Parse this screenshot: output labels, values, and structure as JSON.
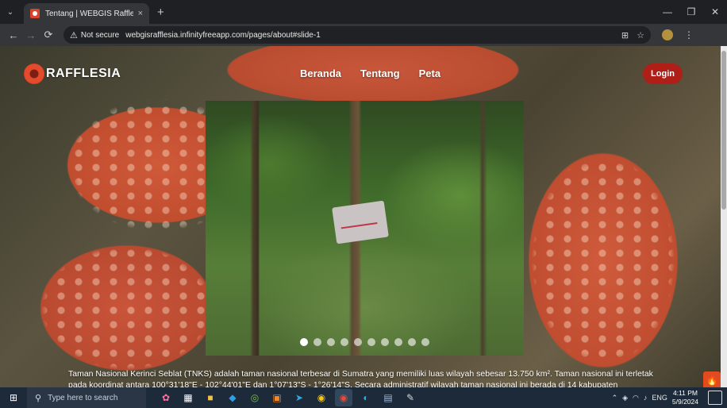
{
  "browser": {
    "tab": {
      "title": "Tentang | WEBGIS Rafflesia SP",
      "close": "×"
    },
    "new_tab": "+",
    "window_controls": {
      "minimize": "—",
      "restore": "❐",
      "close": "✕"
    },
    "nav": {
      "back": "←",
      "forward": "→",
      "reload": "⟳"
    },
    "security": {
      "icon": "⚠",
      "label": "Not secure"
    },
    "url": "webgisrafflesia.infinityfreeapp.com/pages/about#slide-1",
    "omni_icons": {
      "translate": "⊞",
      "bookmark": "☆"
    },
    "menu": "⋮"
  },
  "site": {
    "logo_text": "RAFFLESIA",
    "nav": [
      "Beranda",
      "Tentang",
      "Peta"
    ],
    "login_label": "Login",
    "carousel": {
      "slide_count": 10,
      "active_index": 0
    },
    "description": "Taman Nasional Kerinci Seblat (TNKS) adalah taman nasional terbesar di Sumatra yang memiliki luas wilayah sebesar 13.750 km². Taman nasional ini terletak pada koordinat antara 100°31'18\"E - 102°44'01\"E dan 1°07'13\"S - 1°26'14\"S. Secara administratif wilayah taman nasional ini berada di 14 kabupaten",
    "fab_icon": "flame-icon"
  },
  "taskbar": {
    "search_placeholder": "Type here to search",
    "tray_lang": "ENG",
    "time": "4:11 PM",
    "date": "5/9/2024"
  },
  "colors": {
    "accent": "#b01e18",
    "chrome_dark": "#1f2024",
    "taskbar": "#1c2a3a"
  }
}
